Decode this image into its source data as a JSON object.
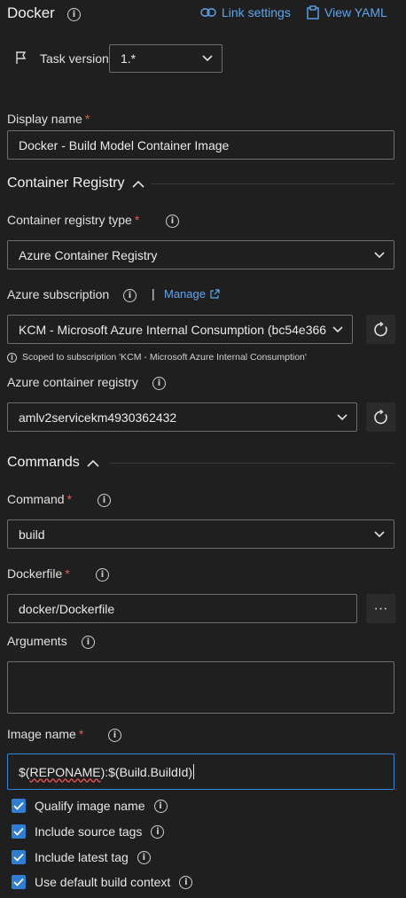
{
  "header": {
    "title": "Docker",
    "link_settings": "Link settings",
    "view_yaml": "View YAML"
  },
  "task_version": {
    "label": "Task version",
    "value": "1.*"
  },
  "display_name": {
    "label": "Display name",
    "required": "*",
    "value": "Docker - Build Model Container Image"
  },
  "container_registry": {
    "section_title": "Container Registry",
    "registry_type_label": "Container registry type",
    "registry_type_value": "Azure Container Registry",
    "subscription_label": "Azure subscription",
    "separator": "|",
    "manage_label": "Manage",
    "subscription_value": "KCM - Microsoft Azure Internal Consumption (bc54e366",
    "scope_note": "Scoped to subscription 'KCM - Microsoft Azure Internal Consumption'",
    "acr_label": "Azure container registry",
    "acr_value": "amlv2servicekm4930362432"
  },
  "commands": {
    "section_title": "Commands",
    "command_label": "Command",
    "command_value": "build",
    "dockerfile_label": "Dockerfile",
    "dockerfile_value": "docker/Dockerfile",
    "browse_label": "···",
    "arguments_label": "Arguments",
    "arguments_value": "",
    "image_name_label": "Image name",
    "image_name_prefix": "$(",
    "image_name_var": "REPONAME",
    "image_name_suffix": "):$(Build.BuildId)"
  },
  "checkboxes": [
    {
      "label": "Qualify image name",
      "checked": true
    },
    {
      "label": "Include source tags",
      "checked": true
    },
    {
      "label": "Include latest tag",
      "checked": true
    },
    {
      "label": "Use default build context",
      "checked": true
    }
  ],
  "colors": {
    "background": "#1f1f1f",
    "accent": "#2e7fd1",
    "link": "#5ea6f0",
    "required": "#e05a5a"
  }
}
